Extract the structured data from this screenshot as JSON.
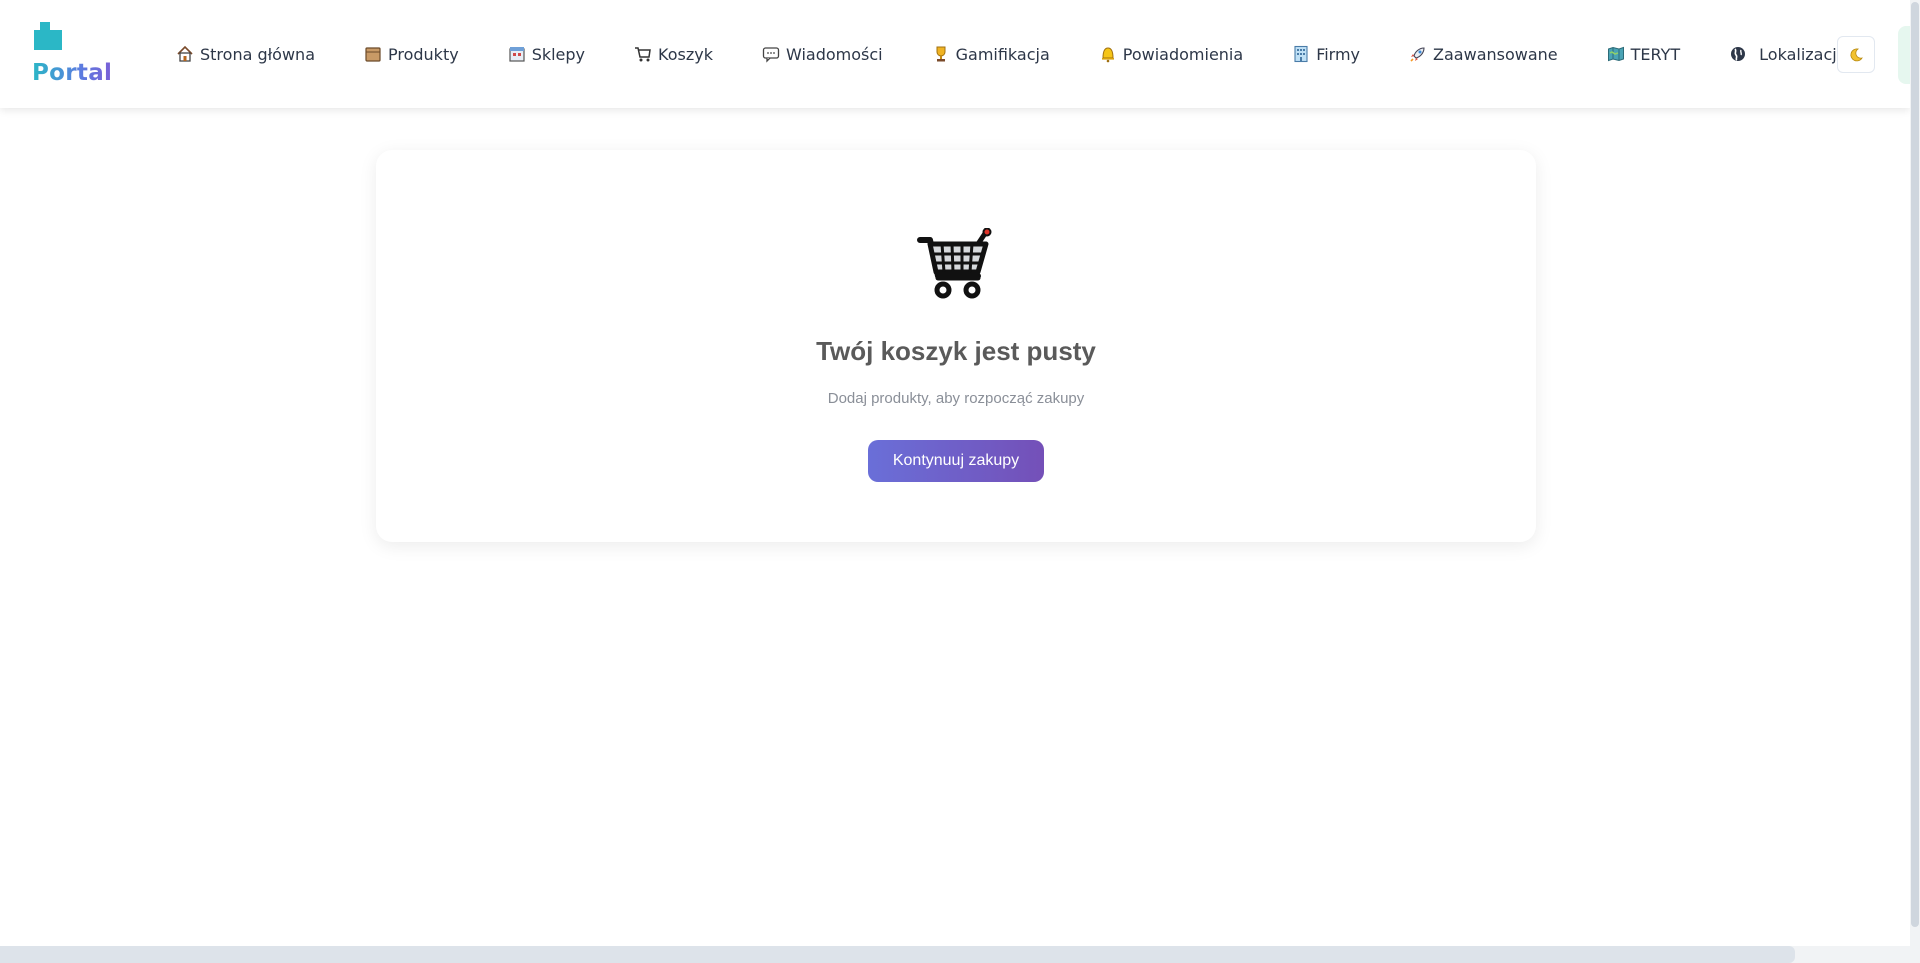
{
  "header": {
    "logo_text": "Portal",
    "nav": [
      {
        "label": "Strona główna",
        "icon": "home-icon"
      },
      {
        "label": "Produkty",
        "icon": "box-icon"
      },
      {
        "label": "Sklepy",
        "icon": "store-icon"
      },
      {
        "label": "Koszyk",
        "icon": "cart-icon"
      },
      {
        "label": "Wiadomości",
        "icon": "message-icon"
      },
      {
        "label": "Gamifikacja",
        "icon": "trophy-icon"
      },
      {
        "label": "Powiadomienia",
        "icon": "bell-icon"
      },
      {
        "label": "Firmy",
        "icon": "building-icon"
      },
      {
        "label": "Zaawansowane",
        "icon": "rocket-icon"
      },
      {
        "label": "TERYT",
        "icon": "map-icon"
      },
      {
        "label": "Lokalizacje",
        "icon": "globe-icon"
      }
    ],
    "theme_toggle_icon": "moon-icon"
  },
  "empty_cart": {
    "title": "Twój koszyk jest pusty",
    "subtitle": "Dodaj produkty, aby rozpocząć zakupy",
    "button": "Kontynuuj zakupy"
  },
  "colors": {
    "accent_start": "#6a6fd8",
    "accent_end": "#7450b8",
    "logo_teal": "#2bb7c6"
  }
}
